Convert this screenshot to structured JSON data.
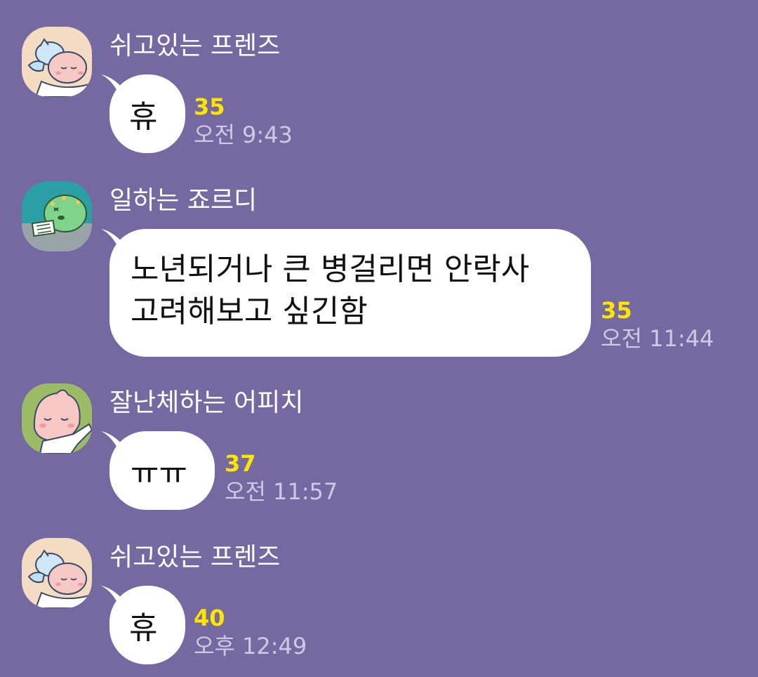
{
  "colors": {
    "background": "#7469a0",
    "bubble": "#ffffff",
    "unread": "#ffe500",
    "time": "#cfcae3",
    "sender": "#ffffff"
  },
  "messages": [
    {
      "sender": "쉬고있는 프렌즈",
      "avatar_icon": "resting-friends-avatar-icon",
      "text": "휴",
      "unread": "35",
      "time": "오전 9:43"
    },
    {
      "sender": "일하는 죠르디",
      "avatar_icon": "working-jordy-avatar-icon",
      "text": "노년되거나 큰 병걸리면 안락사\n고려해보고 싶긴함",
      "unread": "35",
      "time": "오전 11:44"
    },
    {
      "sender": "잘난체하는 어피치",
      "avatar_icon": "boasting-apeach-avatar-icon",
      "text": "ㅠㅠ",
      "unread": "37",
      "time": "오전 11:57"
    },
    {
      "sender": "쉬고있는 프렌즈",
      "avatar_icon": "resting-friends-avatar-icon",
      "text": "휴",
      "unread": "40",
      "time": "오후 12:49"
    }
  ]
}
